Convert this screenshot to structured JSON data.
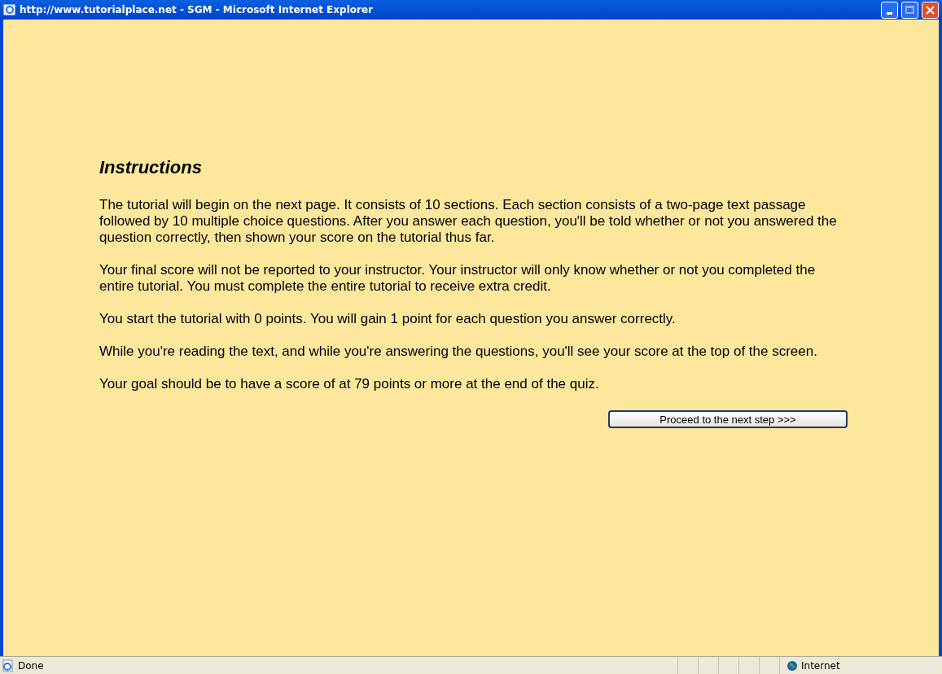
{
  "window": {
    "title": "http://www.tutorialplace.net - SGM - Microsoft Internet Explorer"
  },
  "page": {
    "heading": "Instructions",
    "paragraphs": [
      "The tutorial will begin on the next page. It consists of 10 sections. Each section consists of a two-page text passage followed by 10 multiple choice questions. After you answer each question, you'll be told whether or not you answered the question correctly, then shown your score on the tutorial thus far.",
      "Your final score will not be reported to your instructor. Your instructor will only know whether or not you completed the entire tutorial. You must complete the entire tutorial to receive extra credit.",
      "You start the tutorial with 0 points. You will gain 1 point for each question you answer correctly.",
      "While you're reading the text, and while you're answering the questions, you'll see your score at the top of the screen.",
      "Your goal should be to have a score of at 79 points or more at the end of the quiz."
    ],
    "button": "Proceed to the next step >>>"
  },
  "status_bar": {
    "status": "Done",
    "zone": "Internet"
  }
}
